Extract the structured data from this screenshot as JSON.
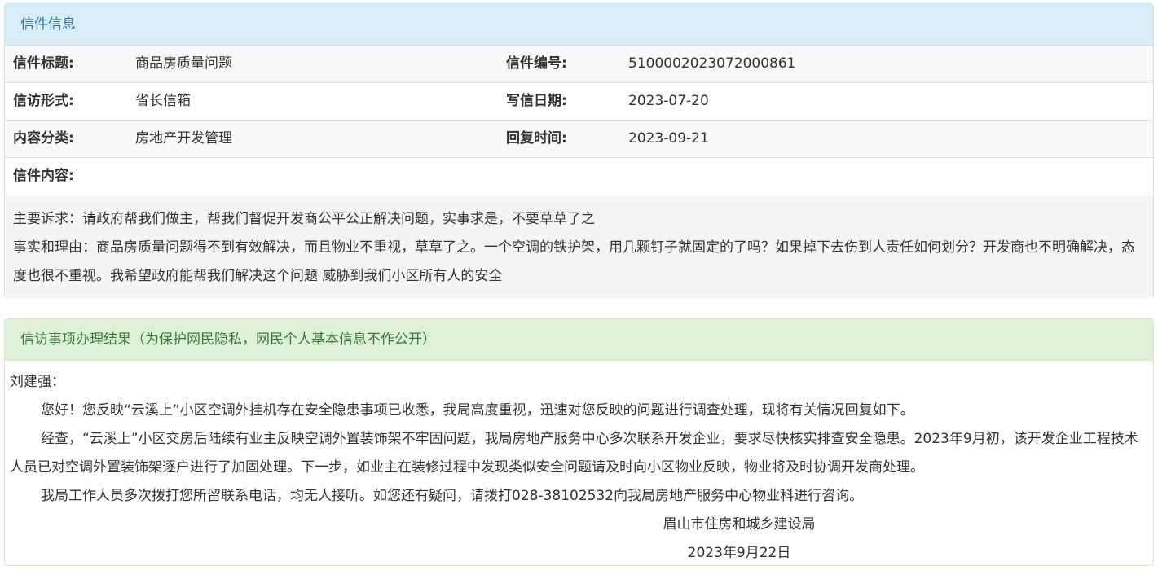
{
  "letter_panel": {
    "title": "信件信息",
    "rows": [
      {
        "label1": "信件标题:",
        "value1": "商品房质量问题",
        "label2": "信件编号:",
        "value2": "5100002023072000861"
      },
      {
        "label1": "信访形式:",
        "value1": "省长信箱",
        "label2": "写信日期:",
        "value2": "2023-07-20"
      },
      {
        "label1": "内容分类:",
        "value1": "房地产开发管理",
        "label2": "回复时间:",
        "value2": "2023-09-21"
      }
    ],
    "content_label": "信件内容:",
    "content_lines": [
      "主要诉求：请政府帮我们做主，帮我们督促开发商公平公正解决问题，实事求是，不要草草了之",
      "事实和理由：商品房质量问题得不到有效解决，而且物业不重视，草草了之。一个空调的铁护架，用几颗钉子就固定的了吗？如果掉下去伤到人责任如何划分？开发商也不明确解决，态度也很不重视。我希望政府能帮我们解决这个问题 威胁到我们小区所有人的安全"
    ]
  },
  "result_panel": {
    "title": "信访事项办理结果（为保护网民隐私，网民个人基本信息不作公开）",
    "salutation": "刘建强：",
    "paragraphs": [
      "您好！您反映“云溪上”小区空调外挂机存在安全隐患事项已收悉，我局高度重视，迅速对您反映的问题进行调查处理，现将有关情况回复如下。",
      "经查，“云溪上”小区交房后陆续有业主反映空调外置装饰架不牢固问题，我局房地产服务中心多次联系开发企业，要求尽快核实排查安全隐患。2023年9月初，该开发企业工程技术人员已对空调外置装饰架逐户进行了加固处理。下一步，如业主在装修过程中发现类似安全问题请及时向小区物业反映，物业将及时协调开发商处理。",
      "我局工作人员多次拨打您所留联系电话，均无人接听。如您还有疑问，请拨打028-38102532向我局房地产服务中心物业科进行咨询。"
    ],
    "signature": "眉山市住房和城乡建设局",
    "date": "2023年9月22日"
  }
}
